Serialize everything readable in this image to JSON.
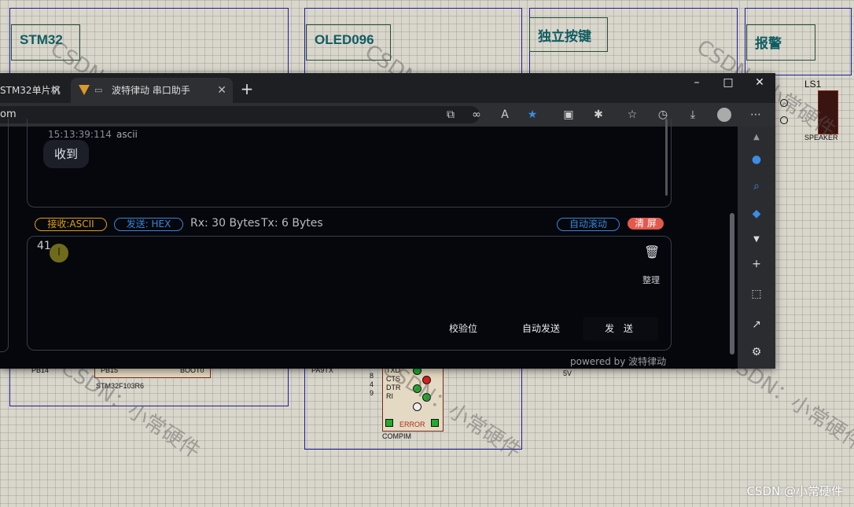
{
  "schematic": {
    "labels": [
      "STM32",
      "OLED096",
      "独立按键",
      "报警"
    ],
    "watermark": "CSDN：小常硬件",
    "speaker": {
      "ref": "LS1",
      "name": "SPEAKER"
    },
    "stm32_pins": {
      "pb14": "PB14",
      "pb15": "PB15",
      "boot0": "BOOT0",
      "part": "STM32F103R6"
    },
    "com_pins": {
      "pa9": "PA9TX",
      "txd": "TXD",
      "cts": "CTS",
      "dtr": "DTR",
      "ri": "RI",
      "error": "ERROR",
      "part": "COMPIM",
      "n8": "8",
      "n4": "4",
      "n9": "9"
    },
    "v5": "5V",
    "csdn_mark": "CSDN @小常硬件"
  },
  "browser": {
    "tabs": [
      {
        "label": "STM32单片机",
        "active": false
      },
      {
        "label": "波特律动 串口助手",
        "active": true
      }
    ],
    "address": "om",
    "window_buttons": {
      "minimize": "–",
      "maximize": "□",
      "close": "✕"
    }
  },
  "serial": {
    "message": {
      "timestamp": "15:13:39:114",
      "format": "ascii",
      "text": "收到"
    },
    "status": {
      "recv_mode": "接收:ASCII",
      "send_mode": "发送: HEX",
      "rx": "Rx: 30 Bytes",
      "tx": "Tx: 6 Bytes",
      "auto_scroll": "自动滚动",
      "clear": "清 屏"
    },
    "input": {
      "value": "41"
    },
    "arrange_label": "整理",
    "buttons": {
      "checksum": "校验位",
      "auto_send": "自动发送",
      "send": "发 送"
    },
    "powered_by": "powered by 波特律动"
  },
  "colors": {
    "recv_pill": "#e0a010",
    "send_pill": "#3a86d6",
    "clear_btn": "#e35a4d",
    "panel_bg": "#05070d"
  }
}
